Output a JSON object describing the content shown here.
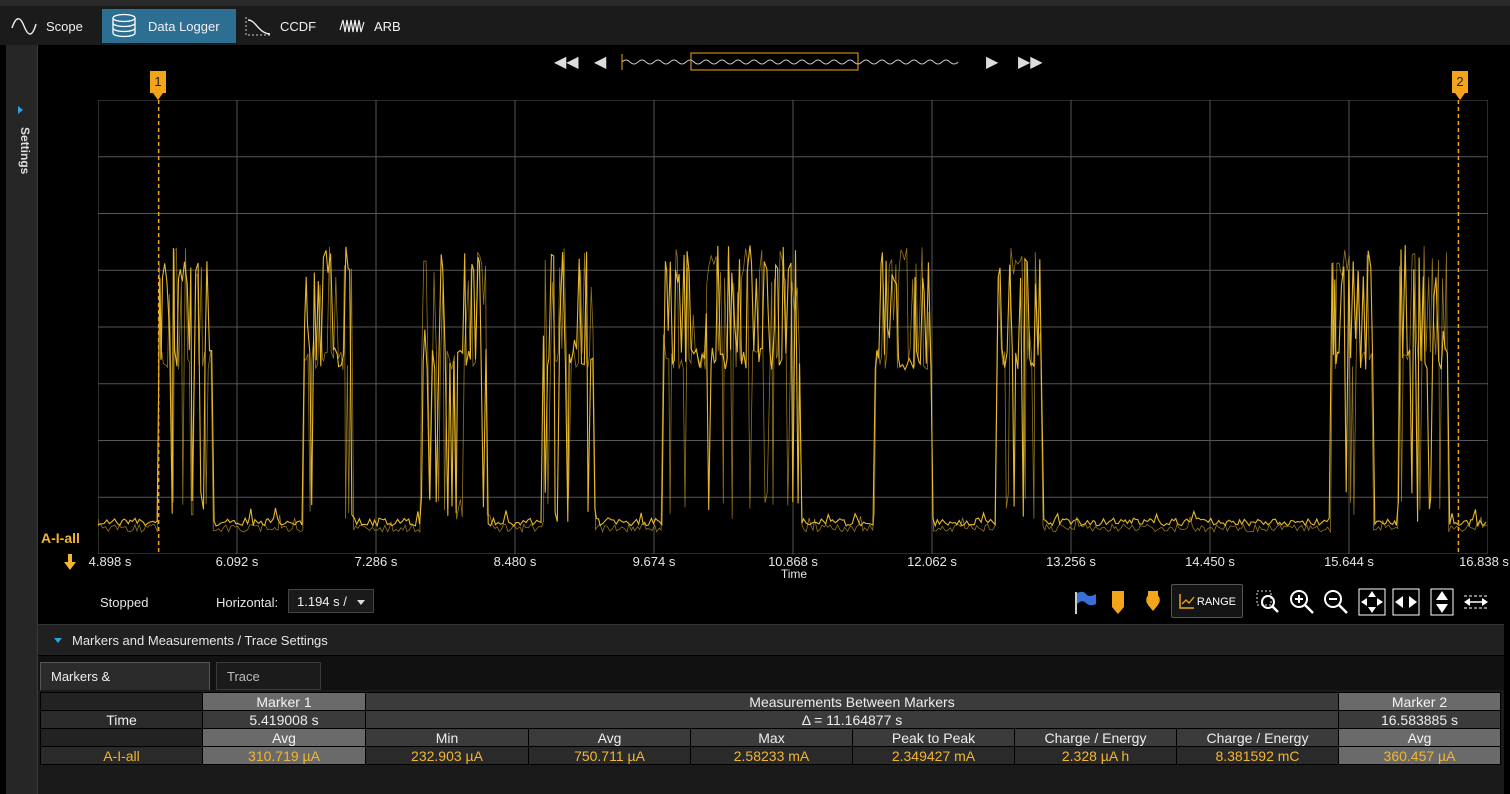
{
  "tabs": [
    {
      "label": "Scope",
      "icon": "sine-wave-icon"
    },
    {
      "label": "Data Logger",
      "icon": "database-icon"
    },
    {
      "label": "CCDF",
      "icon": "ccdf-curve-icon"
    },
    {
      "label": "ARB",
      "icon": "arb-waveform-icon"
    }
  ],
  "active_tab": "Data Logger",
  "sidebar": {
    "label": "Settings"
  },
  "plot": {
    "trace_name": "A-I-all",
    "trace_color": "#f2c12e",
    "marker_color": "#f2a51a",
    "xaxis_label": "Time",
    "xticks": [
      "4.898 s",
      "6.092 s",
      "7.286 s",
      "8.480 s",
      "9.674 s",
      "10.868 s",
      "12.062 s",
      "13.256 s",
      "14.450 s",
      "15.644 s",
      "16.838 s"
    ],
    "markers": [
      {
        "label": "1",
        "time_s": 5.419008
      },
      {
        "label": "2",
        "time_s": 16.583885
      }
    ],
    "x_range_s": [
      4.898,
      16.838
    ]
  },
  "toolbar": {
    "status": "Stopped",
    "horizontal_label": "Horizontal:",
    "horizontal_value": "1.194 s /",
    "range_label": "RANGE",
    "icons": [
      "flag-icon",
      "marker-icon",
      "auto-marker-icon",
      "range-icon",
      "zoom-box-icon",
      "zoom-in-icon",
      "zoom-out-icon",
      "fit-all-icon",
      "fit-horizontal-icon",
      "fit-vertical-icon",
      "scroll-horizontal-icon"
    ]
  },
  "section": {
    "title": "Markers and Measurements / Trace Settings"
  },
  "subtabs": [
    "Markers & Measurements",
    "Trace Settings"
  ],
  "table": {
    "marker1_header": "Marker 1",
    "between_header": "Measurements Between Markers",
    "marker2_header": "Marker 2",
    "time_label": "Time",
    "marker1_time": "5.419008 s",
    "delta": "Δ = 11.164877 s",
    "marker2_time": "16.583885 s",
    "col_headers": [
      "Avg",
      "Min",
      "Avg",
      "Max",
      "Peak to Peak",
      "Charge / Energy",
      "Charge / Energy",
      "Avg"
    ],
    "row_label": "A-I-all",
    "row_values": [
      "310.719 µA",
      "232.903 µA",
      "750.711 µA",
      "2.58233 mA",
      "2.349427 mA",
      "2.328 µA h",
      "8.381592 mC",
      "360.457 µA"
    ]
  }
}
